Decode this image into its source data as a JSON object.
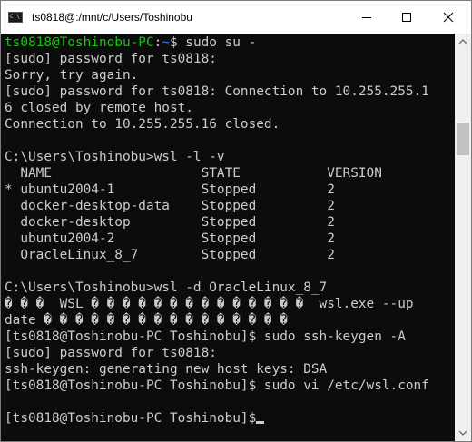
{
  "window": {
    "title": "ts0818@:/mnt/c/Users/Toshinobu",
    "icon_glyph": "C:\\",
    "controls": {
      "minimize": "minimize-icon",
      "maximize": "maximize-icon",
      "close": "close-icon"
    }
  },
  "colors": {
    "background": "#0c0c0c",
    "text": "#cccccc",
    "prompt_user": "#16c60c",
    "prompt_path": "#3b78ff",
    "titlebar": "#ffffff"
  },
  "terminal": {
    "lines": [
      [
        {
          "t": "ts0818@Toshinobu-PC",
          "c": "green"
        },
        {
          "t": ":",
          "c": "white"
        },
        {
          "t": "~",
          "c": "blue"
        },
        {
          "t": "$ sudo su -",
          "c": "white"
        }
      ],
      [
        {
          "t": "[sudo] password for ts0818:"
        }
      ],
      [
        {
          "t": "Sorry, try again."
        }
      ],
      [
        {
          "t": "[sudo] password for ts0818: Connection to 10.255.255.1"
        }
      ],
      [
        {
          "t": "6 closed by remote host."
        }
      ],
      [
        {
          "t": "Connection to 10.255.255.16 closed."
        }
      ],
      [
        {
          "t": ""
        }
      ],
      [
        {
          "t": "C:\\Users\\Toshinobu>wsl -l -v"
        }
      ],
      [
        {
          "t": "  NAME                   STATE           VERSION"
        }
      ],
      [
        {
          "t": "* ubuntu2004-1           Stopped         2"
        }
      ],
      [
        {
          "t": "  docker-desktop-data    Stopped         2"
        }
      ],
      [
        {
          "t": "  docker-desktop         Stopped         2"
        }
      ],
      [
        {
          "t": "  ubuntu2004-2           Stopped         2"
        }
      ],
      [
        {
          "t": "  OracleLinux_8_7        Stopped         2"
        }
      ],
      [
        {
          "t": ""
        }
      ],
      [
        {
          "t": "C:\\Users\\Toshinobu>wsl -d OracleLinux_8_7"
        }
      ],
      [
        {
          "t": "� � �  WSL � � � � � � � � � � � � � �  wsl.exe --up"
        }
      ],
      [
        {
          "t": "date � � � � � � � � � � � � � � � �"
        }
      ],
      [
        {
          "t": "[ts0818@Toshinobu-PC Toshinobu]$ sudo ssh-keygen -A"
        }
      ],
      [
        {
          "t": "[sudo] password for ts0818:"
        }
      ],
      [
        {
          "t": "ssh-keygen: generating new host keys: DSA"
        }
      ],
      [
        {
          "t": "[ts0818@Toshinobu-PC Toshinobu]$ sudo vi /etc/wsl.conf"
        }
      ],
      [
        {
          "t": ""
        }
      ],
      [
        {
          "t": "[ts0818@Toshinobu-PC Toshinobu]$"
        },
        {
          "cursor": true
        }
      ]
    ]
  },
  "scrollbar": {
    "up": "scroll-up-arrow-icon",
    "down": "scroll-down-arrow-icon"
  }
}
